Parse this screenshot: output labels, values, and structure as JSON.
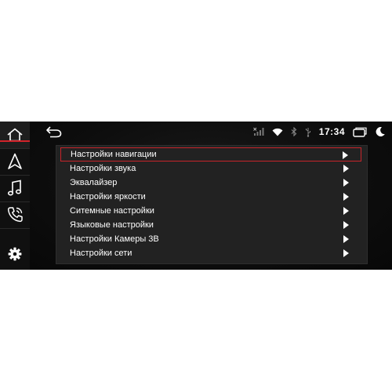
{
  "status": {
    "time": "17:34",
    "icons": [
      "no-signal-icon",
      "wifi-icon",
      "bluetooth-icon",
      "usb-icon",
      "window-icon",
      "night-mode-icon"
    ]
  },
  "nav": {
    "items": [
      "home-icon",
      "navigation-icon",
      "music-icon",
      "phone-icon",
      "settings-icon"
    ],
    "accent_color": "#d2232a"
  },
  "menu": {
    "items": [
      {
        "label": "Настройки навигации",
        "selected": true
      },
      {
        "label": "Настройки звука",
        "selected": false
      },
      {
        "label": "Эквалайзер",
        "selected": false
      },
      {
        "label": "Настройки яркости",
        "selected": false
      },
      {
        "label": "Ситемные настройки",
        "selected": false
      },
      {
        "label": "Языковые настройки",
        "selected": false
      },
      {
        "label": "Настройки Камеры 3В",
        "selected": false
      },
      {
        "label": "Настройки сети",
        "selected": false
      }
    ],
    "selection_color": "#c8242a"
  }
}
